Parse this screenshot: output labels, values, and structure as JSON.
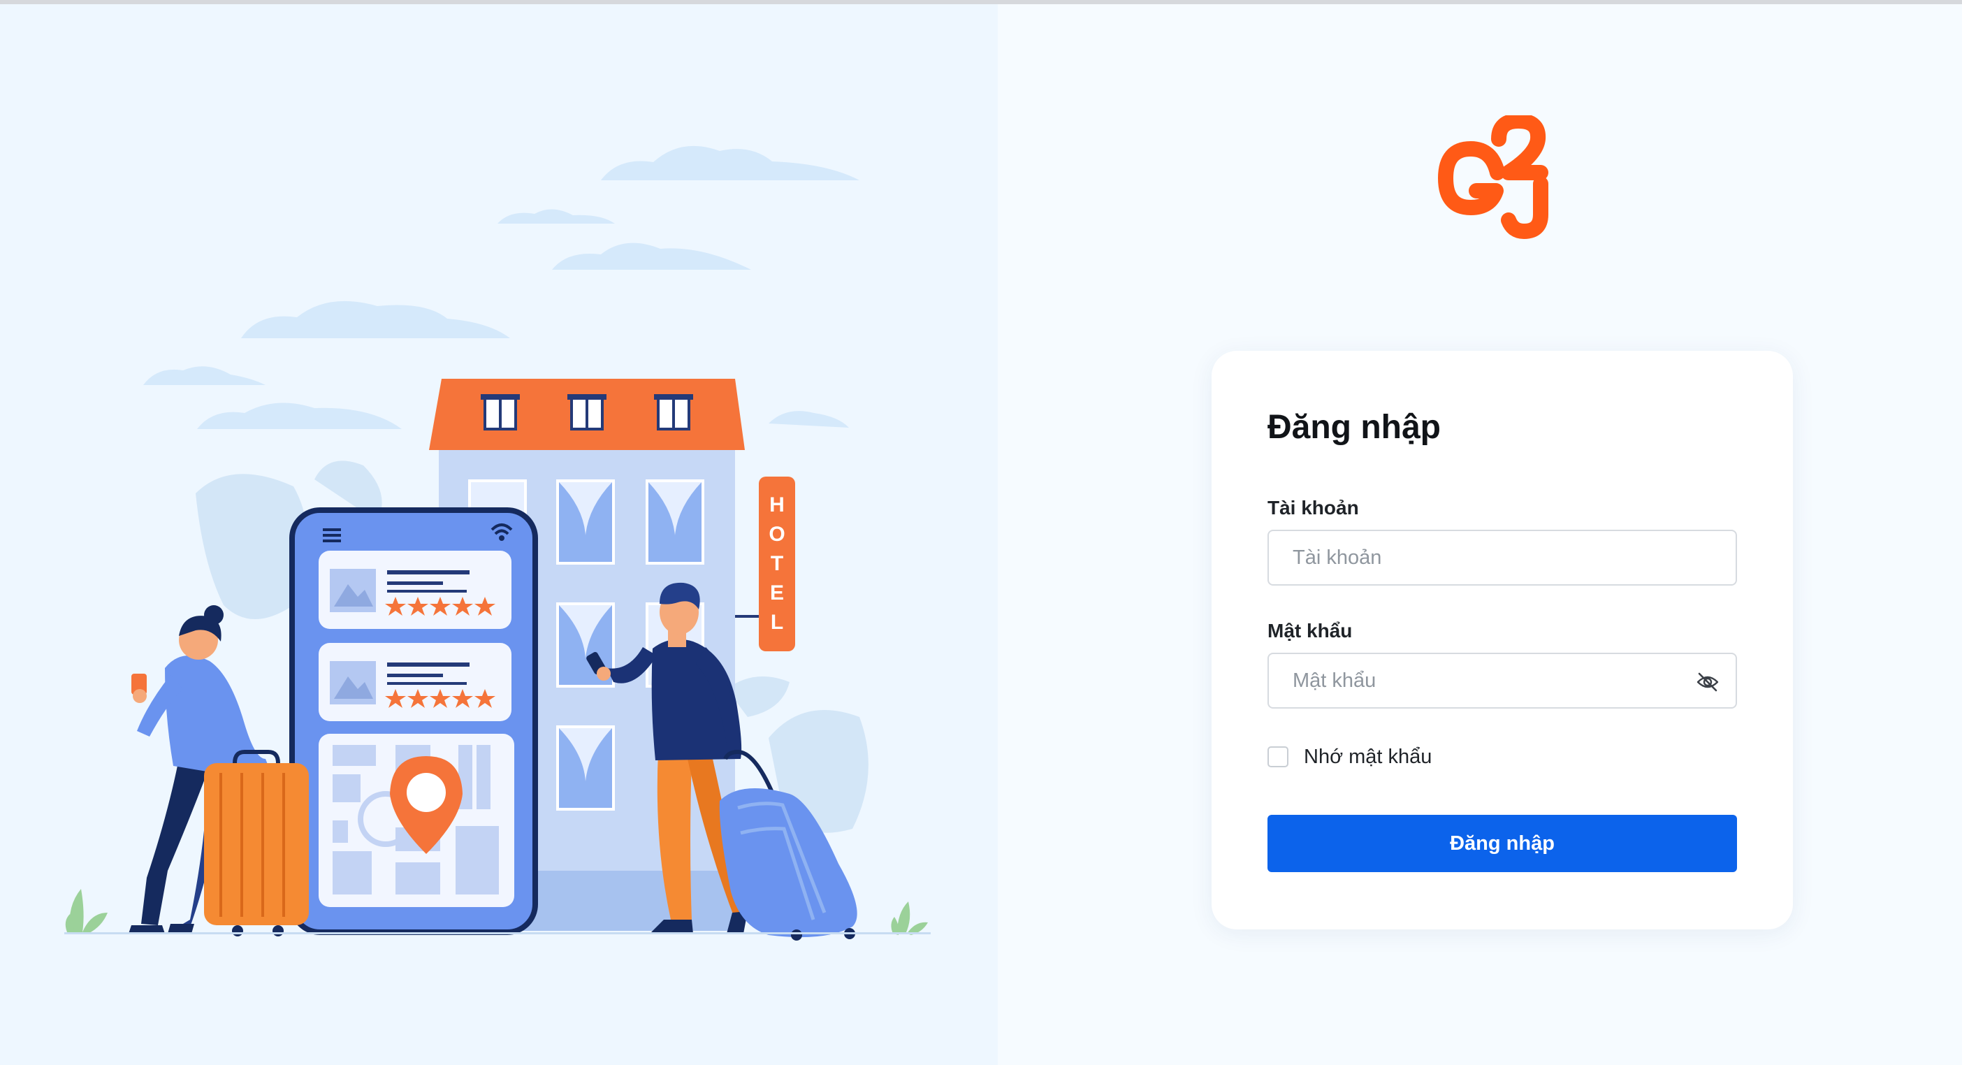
{
  "brand": {
    "logo_text": "G2J",
    "accent_color": "#ff5a16"
  },
  "illustration": {
    "hotel_sign": [
      "H",
      "O",
      "T",
      "E",
      "L"
    ],
    "rating_stars": [
      5,
      5
    ]
  },
  "login": {
    "title": "Đăng nhập",
    "username": {
      "label": "Tài khoản",
      "placeholder": "Tài khoản",
      "value": ""
    },
    "password": {
      "label": "Mật khẩu",
      "placeholder": "Mật khẩu",
      "value": "",
      "toggle_icon": "eye-off-icon"
    },
    "remember": {
      "label": "Nhớ mật khẩu",
      "checked": false
    },
    "submit_label": "Đăng nhập",
    "submit_color": "#0c63eb"
  }
}
